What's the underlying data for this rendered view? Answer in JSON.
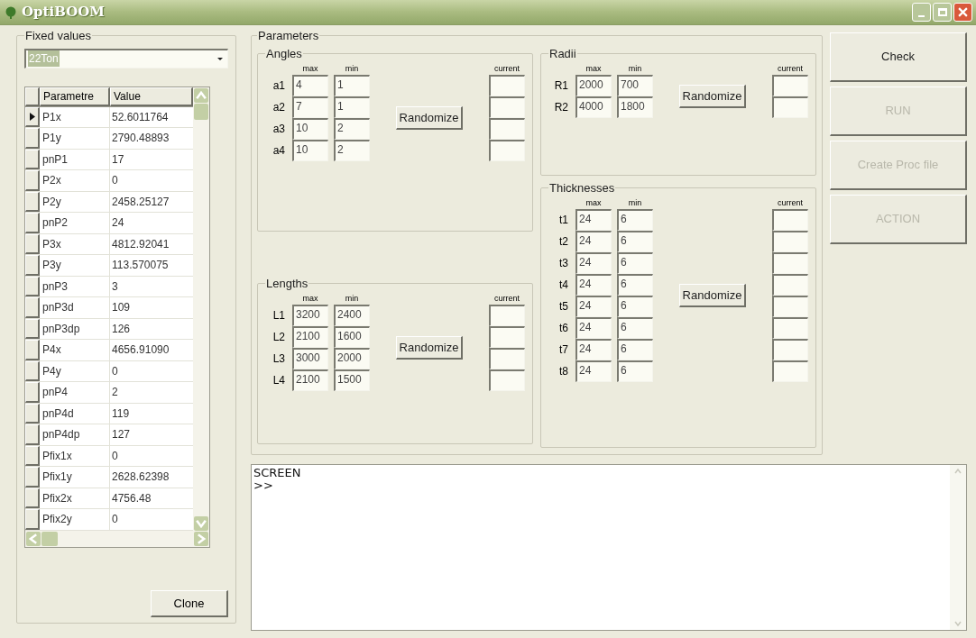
{
  "window": {
    "title": "OptiBOOM"
  },
  "fixed_values": {
    "title": "Fixed values",
    "preset": "22Ton",
    "table": {
      "columns": [
        "Parametre",
        "Value"
      ],
      "rows": [
        {
          "parameter": "P1x",
          "value": "52.6011764",
          "selected": true
        },
        {
          "parameter": "P1y",
          "value": "2790.48893",
          "selected": false
        },
        {
          "parameter": "pnP1",
          "value": "17",
          "selected": false
        },
        {
          "parameter": "P2x",
          "value": "0",
          "selected": false
        },
        {
          "parameter": "P2y",
          "value": "2458.25127",
          "selected": false
        },
        {
          "parameter": "pnP2",
          "value": "24",
          "selected": false
        },
        {
          "parameter": "P3x",
          "value": "4812.92041",
          "selected": false
        },
        {
          "parameter": "P3y",
          "value": "113.570075",
          "selected": false
        },
        {
          "parameter": "pnP3",
          "value": "3",
          "selected": false
        },
        {
          "parameter": "pnP3d",
          "value": "109",
          "selected": false
        },
        {
          "parameter": "pnP3dp",
          "value": "126",
          "selected": false
        },
        {
          "parameter": "P4x",
          "value": "4656.91090",
          "selected": false
        },
        {
          "parameter": "P4y",
          "value": "0",
          "selected": false
        },
        {
          "parameter": "pnP4",
          "value": "2",
          "selected": false
        },
        {
          "parameter": "pnP4d",
          "value": "119",
          "selected": false
        },
        {
          "parameter": "pnP4dp",
          "value": "127",
          "selected": false
        },
        {
          "parameter": "Pfix1x",
          "value": "0",
          "selected": false
        },
        {
          "parameter": "Pfix1y",
          "value": "2628.62398",
          "selected": false
        },
        {
          "parameter": "Pfix2x",
          "value": "4756.48",
          "selected": false
        },
        {
          "parameter": "Pfix2y",
          "value": "0",
          "selected": false
        }
      ]
    },
    "clone_button": "Clone"
  },
  "parameters": {
    "title": "Parameters",
    "groups": [
      {
        "title": "Angles",
        "headers": {
          "max": "max",
          "min": "min",
          "current": "current"
        },
        "button": "Randomize",
        "rows": [
          {
            "label": "a1",
            "max": "4",
            "min": "1"
          },
          {
            "label": "a2",
            "max": "7",
            "min": "1"
          },
          {
            "label": "a3",
            "max": "10",
            "min": "2"
          },
          {
            "label": "a4",
            "max": "10",
            "min": "2"
          }
        ]
      },
      {
        "title": "Lengths",
        "headers": {
          "max": "max",
          "min": "min",
          "current": "current"
        },
        "button": "Randomize",
        "rows": [
          {
            "label": "L1",
            "max": "3200",
            "min": "2400"
          },
          {
            "label": "L2",
            "max": "2100",
            "min": "1600"
          },
          {
            "label": "L3",
            "max": "3000",
            "min": "2000"
          },
          {
            "label": "L4",
            "max": "2100",
            "min": "1500"
          }
        ]
      },
      {
        "title": "Radii",
        "headers": {
          "max": "max",
          "min": "min",
          "current": "current"
        },
        "button": "Randomize",
        "rows": [
          {
            "label": "R1",
            "max": "2000",
            "min": "700"
          },
          {
            "label": "R2",
            "max": "4000",
            "min": "1800"
          }
        ]
      },
      {
        "title": "Thicknesses",
        "headers": {
          "max": "max",
          "min": "min",
          "current": "current"
        },
        "button": "Randomize",
        "rows": [
          {
            "label": "t1",
            "max": "24",
            "min": "6"
          },
          {
            "label": "t2",
            "max": "24",
            "min": "6"
          },
          {
            "label": "t3",
            "max": "24",
            "min": "6"
          },
          {
            "label": "t4",
            "max": "24",
            "min": "6"
          },
          {
            "label": "t5",
            "max": "24",
            "min": "6"
          },
          {
            "label": "t6",
            "max": "24",
            "min": "6"
          },
          {
            "label": "t7",
            "max": "24",
            "min": "6"
          },
          {
            "label": "t8",
            "max": "24",
            "min": "6"
          }
        ]
      }
    ]
  },
  "actions": [
    {
      "label": "Check",
      "disabled": false
    },
    {
      "label": "RUN",
      "disabled": true
    },
    {
      "label": "Create Proc file",
      "disabled": true
    },
    {
      "label": "ACTION",
      "disabled": true
    }
  ],
  "console": {
    "lines": [
      "SCREEN",
      ">>"
    ]
  }
}
